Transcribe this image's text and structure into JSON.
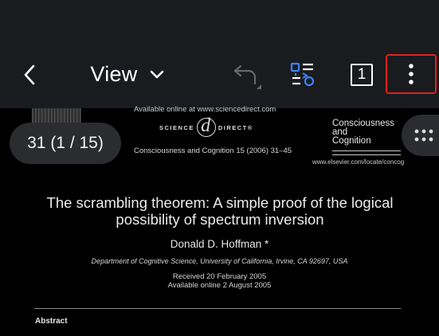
{
  "toolbar": {
    "view_label": "View",
    "page_count_box": "1",
    "icons": [
      "back-chevron-icon",
      "chevron-down-icon",
      "undo-icon",
      "reflow-icon",
      "page-icon",
      "more-vertical-icon"
    ]
  },
  "page_indicator": "31 (1 / 15)",
  "document": {
    "available_online": "Available online at www.sciencedirect.com",
    "science_direct_left": "SCIENCE",
    "science_direct_at": "d",
    "science_direct_right": "DIRECT®",
    "citation": "Consciousness and Cognition 15 (2006) 31–45",
    "journal_line1": "Consciousness",
    "journal_line2": "and",
    "journal_line3": "Cognition",
    "journal_url": "www.elsevier.com/locate/concog",
    "title_line1": "The scrambling theorem: A simple proof of the logical",
    "title_line2": "possibility of spectrum inversion",
    "author": "Donald D. Hoffman *",
    "affiliation": "Department of Cognitive Science, University of California, Irvine, CA 92697, USA",
    "received": "Received 20 February 2005",
    "available": "Available online 2 August 2005",
    "abstract_heading": "Abstract"
  },
  "colors": {
    "toolbar_bg": "#1a1b1e",
    "highlight_border": "#e02020",
    "reflow_icon_blue": "#3b82f6",
    "pill_bg": "#2b2c2f"
  }
}
